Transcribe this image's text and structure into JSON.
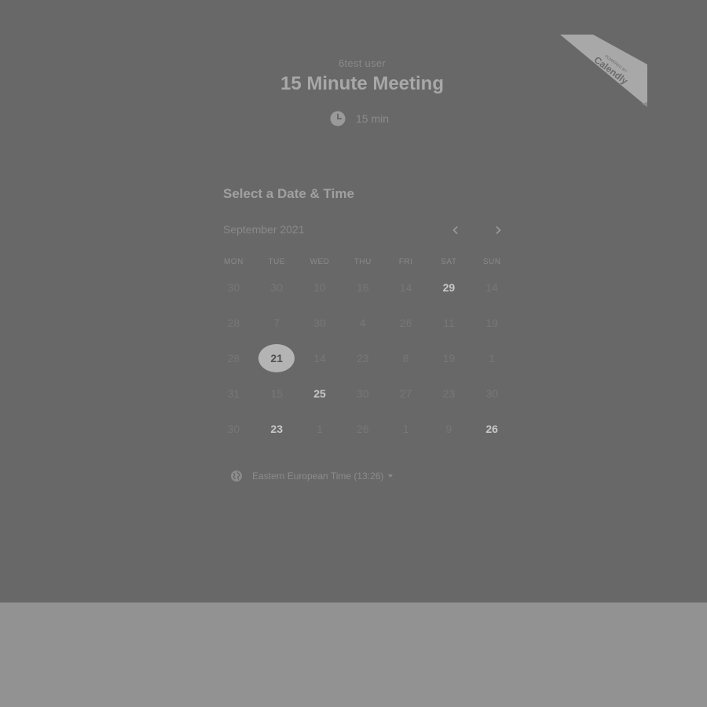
{
  "event": {
    "owner": "6test user",
    "title": "15 Minute Meeting",
    "duration": "15 min"
  },
  "badge": {
    "line1": "POWERED BY",
    "brand": "Calendly"
  },
  "scheduler": {
    "heading": "Select a Date & Time",
    "month": "September 2021",
    "weekdays": [
      "MON",
      "TUE",
      "WED",
      "THU",
      "FRI",
      "SAT",
      "SUN"
    ],
    "weeks": [
      [
        {
          "label": "30",
          "available": false
        },
        {
          "label": "30",
          "available": false
        },
        {
          "label": "10",
          "available": false
        },
        {
          "label": "16",
          "available": false
        },
        {
          "label": "14",
          "available": false
        },
        {
          "label": "29",
          "available": true
        },
        {
          "label": "14",
          "available": false
        }
      ],
      [
        {
          "label": "28",
          "available": false
        },
        {
          "label": "7",
          "available": false
        },
        {
          "label": "30",
          "available": false
        },
        {
          "label": "4",
          "available": false
        },
        {
          "label": "26",
          "available": false
        },
        {
          "label": "11",
          "available": false
        },
        {
          "label": "19",
          "available": false
        }
      ],
      [
        {
          "label": "28",
          "available": false
        },
        {
          "label": "21",
          "available": true,
          "selected": true
        },
        {
          "label": "14",
          "available": false
        },
        {
          "label": "23",
          "available": false
        },
        {
          "label": "8",
          "available": false
        },
        {
          "label": "19",
          "available": false
        },
        {
          "label": "1",
          "available": false
        }
      ],
      [
        {
          "label": "31",
          "available": false
        },
        {
          "label": "15",
          "available": false
        },
        {
          "label": "25",
          "available": true
        },
        {
          "label": "30",
          "available": false
        },
        {
          "label": "27",
          "available": false
        },
        {
          "label": "23",
          "available": false
        },
        {
          "label": "30",
          "available": false
        }
      ],
      [
        {
          "label": "30",
          "available": false
        },
        {
          "label": "23",
          "available": true
        },
        {
          "label": "1",
          "available": false
        },
        {
          "label": "26",
          "available": false
        },
        {
          "label": "1",
          "available": false
        },
        {
          "label": "9",
          "available": false
        },
        {
          "label": "26",
          "available": true
        }
      ]
    ],
    "timezone": "Eastern European Time (13:26)"
  },
  "icons": {
    "duration": "clock-icon",
    "prev": "chevron-left-icon",
    "next": "chevron-right-icon",
    "timezone": "globe-icon",
    "timezone_caret": "caret-down-icon"
  },
  "colors": {
    "overlay": "#686868",
    "page_background": "#929292",
    "selected_day": "#b4b4b4"
  }
}
